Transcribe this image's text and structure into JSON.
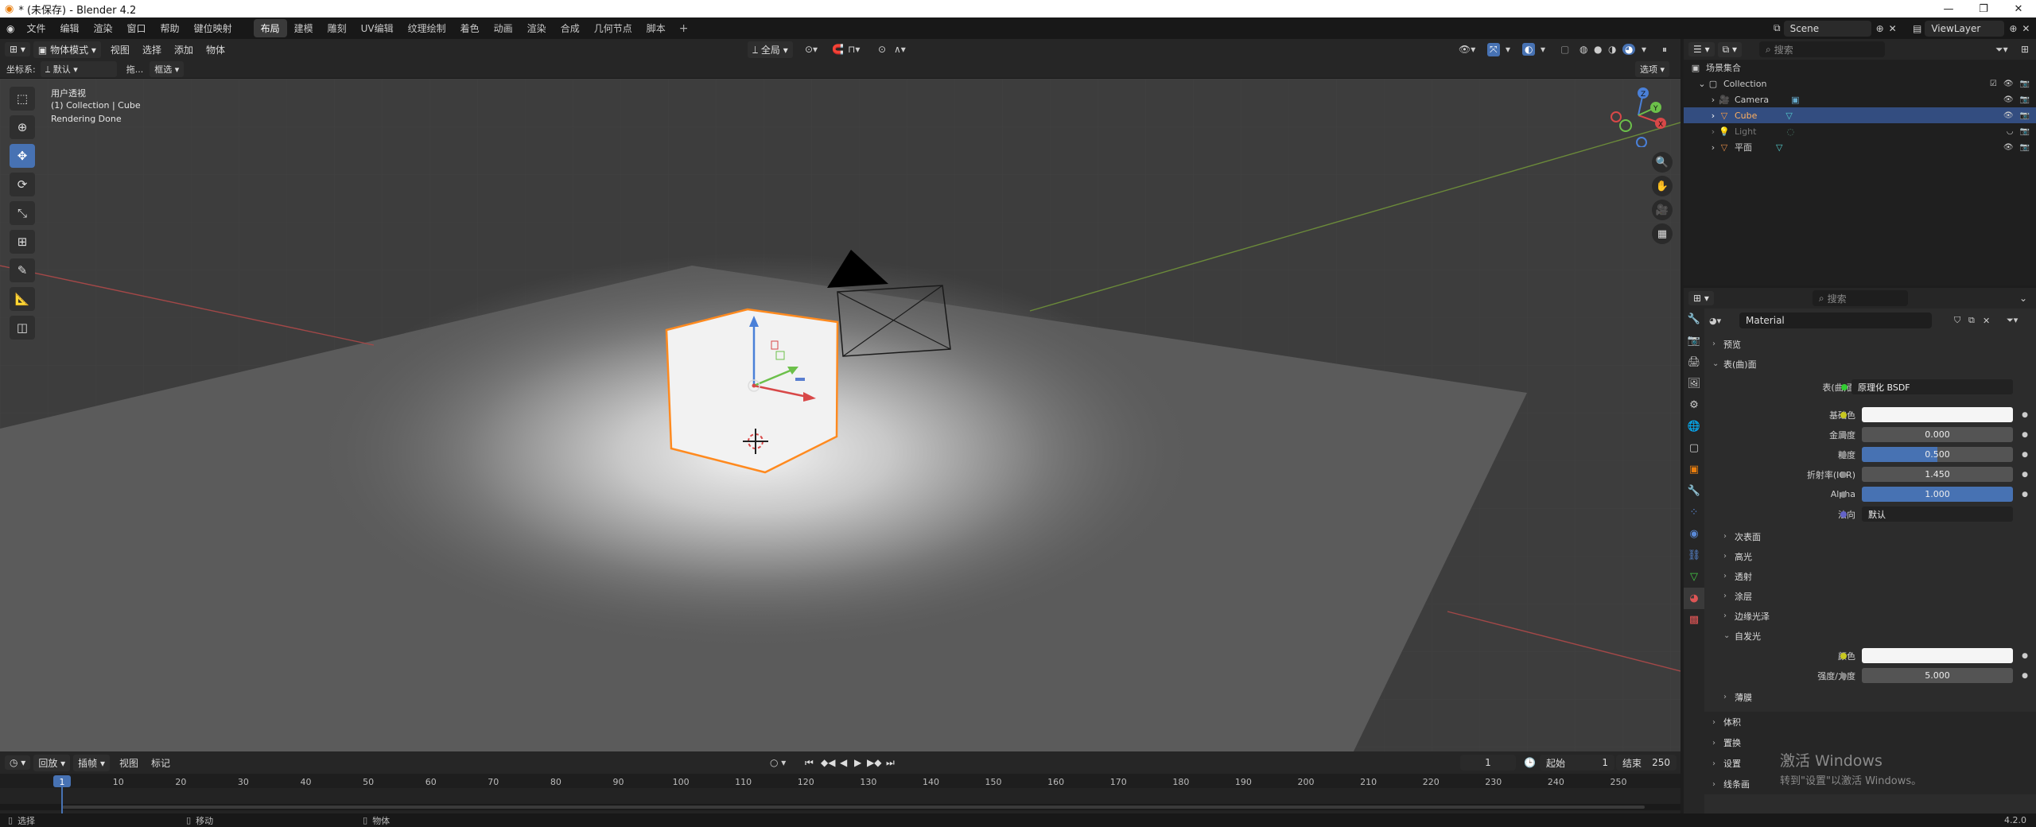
{
  "window": {
    "title": "* (未保存) - Blender 4.2"
  },
  "menu": [
    "文件",
    "编辑",
    "渲染",
    "窗口",
    "帮助",
    "键位映射"
  ],
  "workspaces": [
    {
      "label": "布局",
      "active": true
    },
    {
      "label": "建模"
    },
    {
      "label": "雕刻"
    },
    {
      "label": "UV编辑"
    },
    {
      "label": "纹理绘制"
    },
    {
      "label": "着色"
    },
    {
      "label": "动画"
    },
    {
      "label": "渲染"
    },
    {
      "label": "合成"
    },
    {
      "label": "几何节点"
    },
    {
      "label": "脚本"
    }
  ],
  "topbar_right": {
    "scene": "Scene",
    "viewlayer": "ViewLayer"
  },
  "viewport_header": {
    "mode": "物体模式",
    "menus": [
      "视图",
      "选择",
      "添加",
      "物体"
    ],
    "transform_orientation": "全局",
    "options": "选项"
  },
  "viewport_sub": {
    "coord_label": "坐标系:",
    "coord_value": "默认",
    "drag_label": "拖...",
    "select_value": "框选"
  },
  "viewport": {
    "overlay_line1": "用户透视",
    "overlay_line2": "(1) Collection | Cube",
    "overlay_line3": "Rendering Done"
  },
  "timeline": {
    "menus": [
      "回放",
      "插帧",
      "视图",
      "标记"
    ],
    "current_frame": "1",
    "start_label": "起始",
    "start_value": "1",
    "end_label": "结束",
    "end_value": "250",
    "ruler": [
      "1",
      "10",
      "20",
      "30",
      "40",
      "50",
      "60",
      "70",
      "80",
      "90",
      "100",
      "110",
      "120",
      "130",
      "140",
      "150",
      "160",
      "170",
      "180",
      "190",
      "200",
      "210",
      "220",
      "230",
      "240",
      "250"
    ]
  },
  "outliner": {
    "search_placeholder": "搜索",
    "root": "场景集合",
    "collection": "Collection",
    "items": [
      {
        "label": "Camera",
        "icon": "camera-icon",
        "color": "#e28a45"
      },
      {
        "label": "Cube",
        "icon": "mesh-icon",
        "color": "#e28a45",
        "selected": true
      },
      {
        "label": "Light",
        "icon": "light-icon",
        "color": "#e28a45",
        "dim": true
      },
      {
        "label": "平面",
        "icon": "mesh-icon",
        "color": "#e28a45"
      }
    ]
  },
  "properties": {
    "search_placeholder": "搜索",
    "material_name": "Material",
    "sections": {
      "preview": "预览",
      "surface": "表(曲)面"
    },
    "surface_label": "表(曲)面",
    "surface_value": "原理化 BSDF",
    "fields": [
      {
        "label": "基础色",
        "kind": "white",
        "dot": "#c8c820"
      },
      {
        "label": "金属度",
        "value": "0.000",
        "kind": "grey"
      },
      {
        "label": "糙度",
        "value": "0.500",
        "kind": "blue"
      },
      {
        "label": "折射率(IOR)",
        "value": "1.450",
        "kind": "grey"
      },
      {
        "label": "Alpha",
        "value": "1.000",
        "kind": "blue"
      }
    ],
    "normal_label": "法向",
    "normal_value": "默认",
    "subsections": [
      "次表面",
      "高光",
      "透射",
      "涂层",
      "边缘光泽"
    ],
    "emission_label": "自发光",
    "emission_color_label": "颜色",
    "emission_strength_label": "强度/力度",
    "emission_strength_value": "5.000",
    "thin_film": "薄膜",
    "bottom_sections": [
      "体积",
      "置换",
      "设置",
      "线条画"
    ]
  },
  "status": {
    "select": "选择",
    "move": "移动",
    "object": "物体",
    "version": "4.2.0"
  },
  "watermark": {
    "line1": "激活 Windows",
    "line2": "转到\"设置\"以激活 Windows。"
  }
}
